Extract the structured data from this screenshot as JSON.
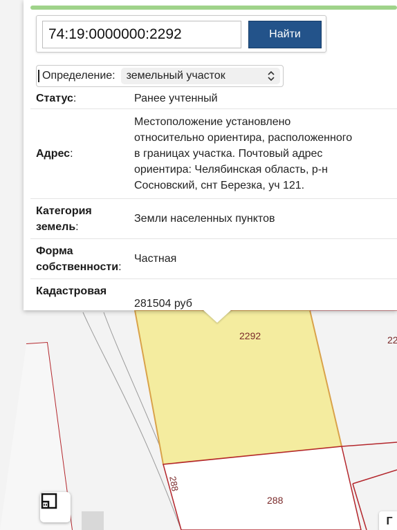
{
  "search": {
    "value": "74:19:0000000:2292",
    "button_label": "Найти"
  },
  "definition": {
    "label": "Определение:",
    "selected": "земельный участок"
  },
  "info": {
    "status_key": "Статус",
    "status_val": "Ранее учтенный",
    "address_key": "Адрес",
    "address_lines": [
      "Местоположение установлено",
      "относительно ориентира, расположенного",
      "в границах участка. Почтовый адрес",
      "ориентира: Челябинская область, р-н",
      "Сосновский, снт Березка, уч 121."
    ],
    "category_key_1": "Категория",
    "category_key_2": "земель",
    "category_val": "Земли населенных пунктов",
    "ownership_key_1": "Форма",
    "ownership_key_2": "собственности",
    "ownership_val": "Частная",
    "cadastral_key": "Кадастровая",
    "cadastral_val": "281504 руб"
  },
  "map": {
    "parcel_label": "2292",
    "neighbor_label": "22",
    "road_label": "288",
    "lower_parcel_label": "288",
    "corner_tool_label": "Г",
    "parcel_fill": "#f4ec9f",
    "boundary_color": "#b3252b"
  },
  "colors": {
    "button": "#23538a",
    "top_bar": "#9fd38a"
  }
}
